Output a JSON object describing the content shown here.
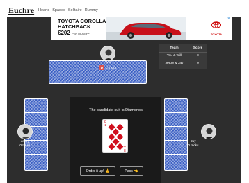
{
  "nav": {
    "brand": "Euchre",
    "links": [
      "Hearts",
      "Spades",
      "Solitaire",
      "Rummy"
    ]
  },
  "ad": {
    "line1": "TOYOTA COROLLA",
    "line2": "HATCHBACK",
    "price": "€202",
    "price_suffix": "PER MONTH*",
    "logo_text": "TOYOTA",
    "close": "✕"
  },
  "scoreboard": {
    "headers": [
      "Team",
      "Score"
    ],
    "rows": [
      {
        "team": "You & Will",
        "score": "0"
      },
      {
        "team": "Jeezy & Jay",
        "score": "0"
      }
    ]
  },
  "players": {
    "top": {
      "name": "Will",
      "tricks": "0 tricks",
      "dealer_badge": "D"
    },
    "left": {
      "name": "Jeezy",
      "tricks": "0 tricks"
    },
    "right": {
      "name": "Jay",
      "tricks": "0 tricks"
    }
  },
  "center": {
    "message": "The candidate suit is Diamonds",
    "card_rank": "8",
    "card_suit": "♦",
    "order_button": "Order it up! 👍",
    "pass_button": "Pass 👈"
  },
  "colors": {
    "table_bg": "#2d2d2d",
    "card_back": "#3b5fc4",
    "dealer_chip": "#d9534f",
    "diamond_red": "#d0101e"
  },
  "icons": {
    "order": "thumbs-up-icon",
    "pass": "hand-pointing-icon"
  }
}
